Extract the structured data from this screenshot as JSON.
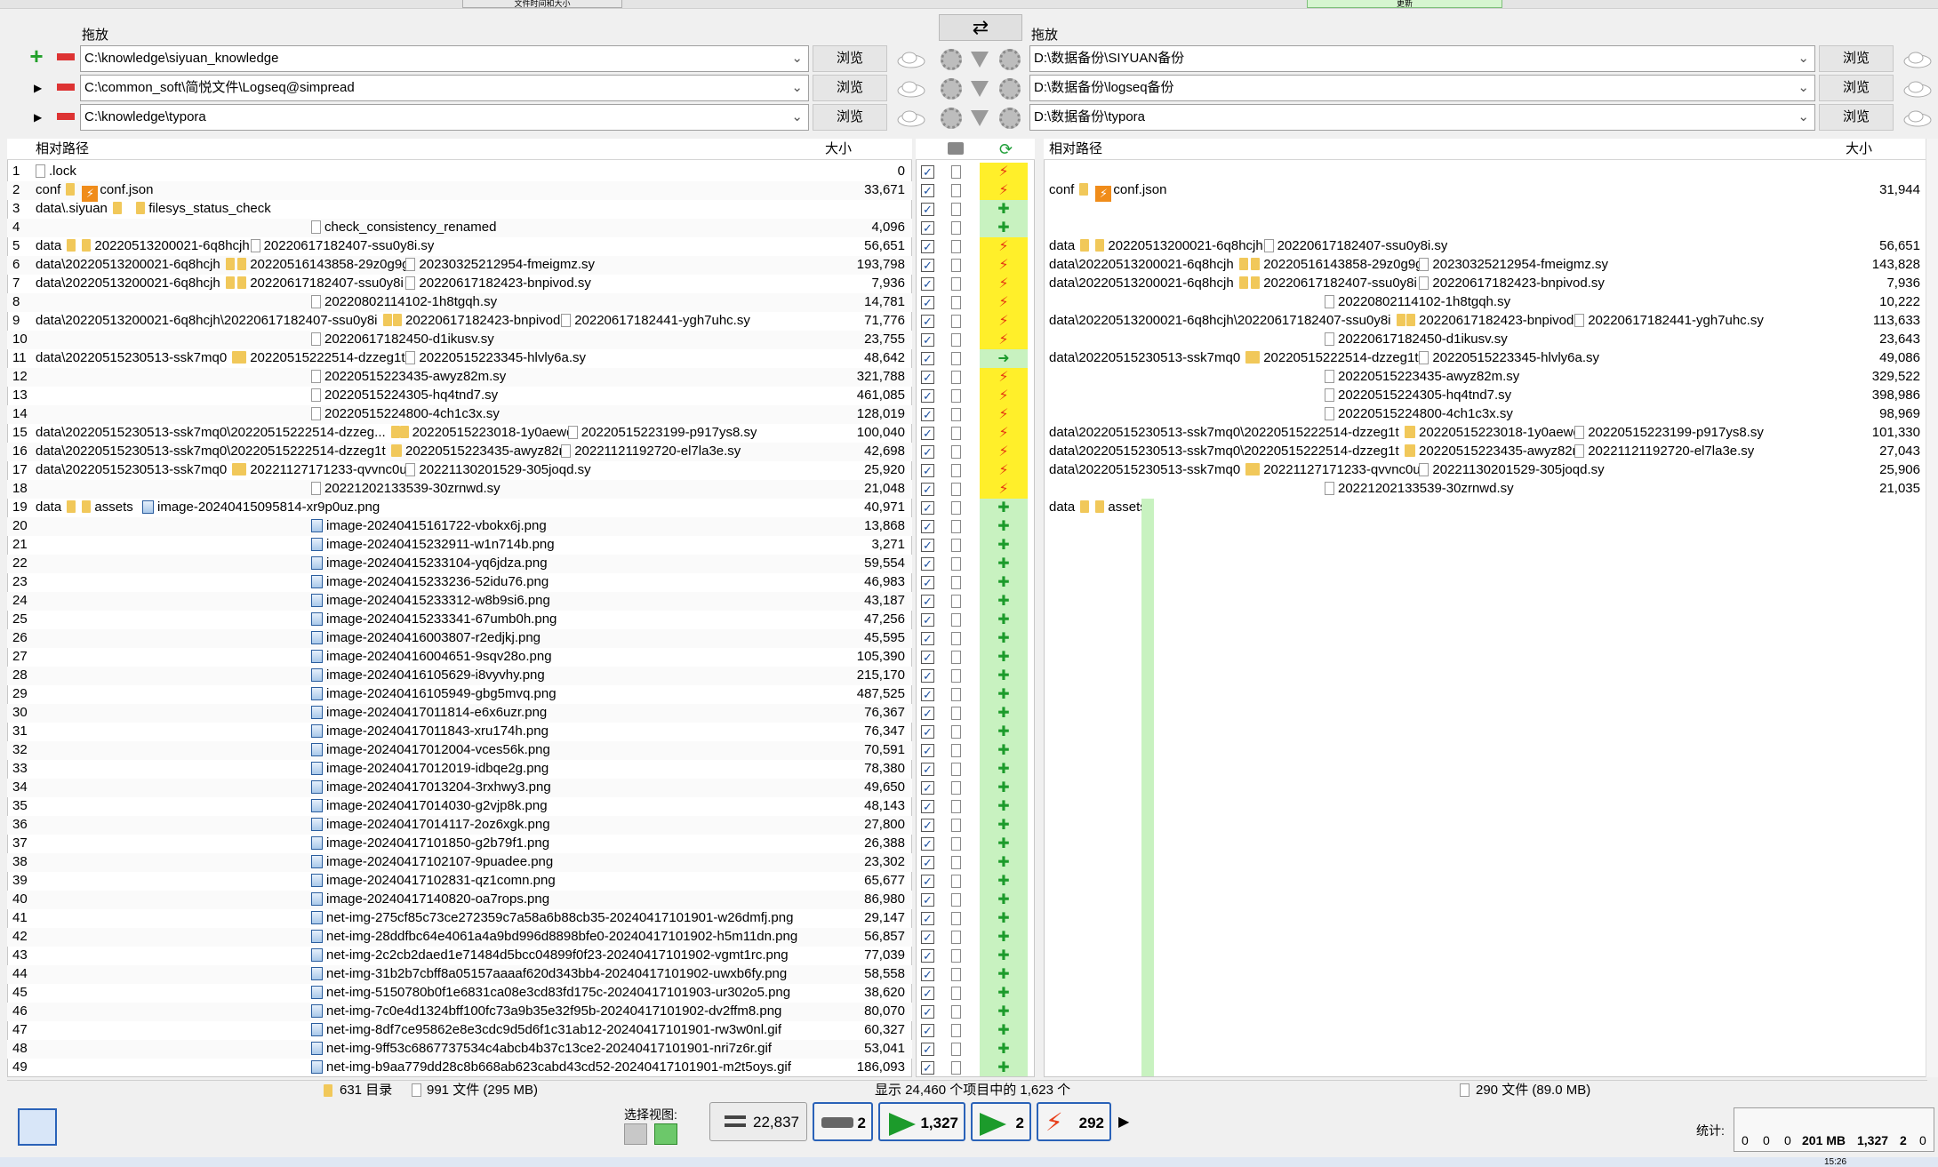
{
  "toolbar": {
    "drag_left": "拖放",
    "drag_right": "拖放",
    "browse": "浏览",
    "top_left_btn": "文件时间和大小",
    "top_right_btn": "更新"
  },
  "left_paths": [
    "C:\\knowledge\\siyuan_knowledge",
    "C:\\common_soft\\简悦文件\\Logseq@simpread",
    "C:\\knowledge\\typora"
  ],
  "right_paths": [
    "D:\\数据备份\\SIYUAN备份",
    "D:\\数据备份\\logseq备份",
    "D:\\数据备份\\typora"
  ],
  "headers": {
    "rel_path": "相对路径",
    "size": "大小"
  },
  "left_rows": [
    {
      "n": "1",
      "c": [
        ".lock"
      ],
      "s": "0",
      "a": "y"
    },
    {
      "n": "2",
      "c": [
        "conf",
        "conf.json"
      ],
      "s": "33,671",
      "a": "y"
    },
    {
      "n": "3",
      "c": [
        "data\\.siyuan",
        "filesys_status_check"
      ],
      "s": "",
      "a": "g"
    },
    {
      "n": "4",
      "c": [
        "",
        "",
        "check_consistency_renamed"
      ],
      "s": "4,096",
      "a": "g"
    },
    {
      "n": "5",
      "c": [
        "data",
        "20220513200021-6q8hcjh",
        "20220617182407-ssu0y8i.sy"
      ],
      "s": "56,651",
      "a": "y"
    },
    {
      "n": "6",
      "c": [
        "data\\20220513200021-6q8hcjh",
        "20220516143858-29z0g9g",
        "20230325212954-fmeigmz.sy"
      ],
      "s": "193,798",
      "a": "y"
    },
    {
      "n": "7",
      "c": [
        "data\\20220513200021-6q8hcjh",
        "20220617182407-ssu0y8i",
        "20220617182423-bnpivod.sy"
      ],
      "s": "7,936",
      "a": "y"
    },
    {
      "n": "8",
      "c": [
        "",
        "",
        "20220802114102-1h8tgqh.sy"
      ],
      "s": "14,781",
      "a": "y"
    },
    {
      "n": "9",
      "c": [
        "data\\20220513200021-6q8hcjh\\20220617182407-ssu0y8i",
        "20220617182423-bnpivod",
        "20220617182441-ygh7uhc.sy"
      ],
      "s": "71,776",
      "a": "y"
    },
    {
      "n": "10",
      "c": [
        "",
        "",
        "20220617182450-d1ikusv.sy"
      ],
      "s": "23,755",
      "a": "y"
    },
    {
      "n": "11",
      "c": [
        "data\\20220515230513-ssk7mq0",
        "20220515222514-dzzeg1t",
        "20220515223345-hlvly6a.sy"
      ],
      "s": "48,642",
      "a": "r"
    },
    {
      "n": "12",
      "c": [
        "",
        "",
        "20220515223435-awyz82m.sy"
      ],
      "s": "321,788",
      "a": "y"
    },
    {
      "n": "13",
      "c": [
        "",
        "",
        "20220515224305-hq4tnd7.sy"
      ],
      "s": "461,085",
      "a": "y"
    },
    {
      "n": "14",
      "c": [
        "",
        "",
        "20220515224800-4ch1c3x.sy"
      ],
      "s": "128,019",
      "a": "y"
    },
    {
      "n": "15",
      "c": [
        "data\\20220515230513-ssk7mq0\\20220515222514-dzzeg...",
        "20220515223018-1y0aewd",
        "20220515223199-p917ys8.sy"
      ],
      "s": "100,040",
      "a": "y"
    },
    {
      "n": "16",
      "c": [
        "data\\20220515230513-ssk7mq0\\20220515222514-dzzeg1t",
        "20220515223435-awyz82m",
        "20221121192720-el7la3e.sy"
      ],
      "s": "42,698",
      "a": "y"
    },
    {
      "n": "17",
      "c": [
        "data\\20220515230513-ssk7mq0",
        "20221127171233-qvvnc0u",
        "20221130201529-305joqd.sy"
      ],
      "s": "25,920",
      "a": "y"
    },
    {
      "n": "18",
      "c": [
        "",
        "",
        "20221202133539-30zrnwd.sy"
      ],
      "s": "21,048",
      "a": "y"
    },
    {
      "n": "19",
      "c": [
        "data",
        "assets",
        "image-20240415095814-xr9p0uz.png"
      ],
      "s": "40,971",
      "a": "g"
    },
    {
      "n": "20",
      "c": [
        "",
        "",
        "image-20240415161722-vbokx6j.png"
      ],
      "s": "13,868",
      "a": "g"
    },
    {
      "n": "21",
      "c": [
        "",
        "",
        "image-20240415232911-w1n714b.png"
      ],
      "s": "3,271",
      "a": "g"
    },
    {
      "n": "22",
      "c": [
        "",
        "",
        "image-20240415233104-yq6jdza.png"
      ],
      "s": "59,554",
      "a": "g"
    },
    {
      "n": "23",
      "c": [
        "",
        "",
        "image-20240415233236-52idu76.png"
      ],
      "s": "46,983",
      "a": "g"
    },
    {
      "n": "24",
      "c": [
        "",
        "",
        "image-20240415233312-w8b9si6.png"
      ],
      "s": "43,187",
      "a": "g"
    },
    {
      "n": "25",
      "c": [
        "",
        "",
        "image-20240415233341-67umb0h.png"
      ],
      "s": "47,256",
      "a": "g"
    },
    {
      "n": "26",
      "c": [
        "",
        "",
        "image-20240416003807-r2edjkj.png"
      ],
      "s": "45,595",
      "a": "g"
    },
    {
      "n": "27",
      "c": [
        "",
        "",
        "image-20240416004651-9sqv28o.png"
      ],
      "s": "105,390",
      "a": "g"
    },
    {
      "n": "28",
      "c": [
        "",
        "",
        "image-20240416105629-i8vyvhy.png"
      ],
      "s": "215,170",
      "a": "g"
    },
    {
      "n": "29",
      "c": [
        "",
        "",
        "image-20240416105949-gbg5mvq.png"
      ],
      "s": "487,525",
      "a": "g"
    },
    {
      "n": "30",
      "c": [
        "",
        "",
        "image-20240417011814-e6x6uzr.png"
      ],
      "s": "76,367",
      "a": "g"
    },
    {
      "n": "31",
      "c": [
        "",
        "",
        "image-20240417011843-xru174h.png"
      ],
      "s": "76,347",
      "a": "g"
    },
    {
      "n": "32",
      "c": [
        "",
        "",
        "image-20240417012004-vces56k.png"
      ],
      "s": "70,591",
      "a": "g"
    },
    {
      "n": "33",
      "c": [
        "",
        "",
        "image-20240417012019-idbqe2g.png"
      ],
      "s": "78,380",
      "a": "g"
    },
    {
      "n": "34",
      "c": [
        "",
        "",
        "image-20240417013204-3rxhwy3.png"
      ],
      "s": "49,650",
      "a": "g"
    },
    {
      "n": "35",
      "c": [
        "",
        "",
        "image-20240417014030-g2vjp8k.png"
      ],
      "s": "48,143",
      "a": "g"
    },
    {
      "n": "36",
      "c": [
        "",
        "",
        "image-20240417014117-2oz6xgk.png"
      ],
      "s": "27,800",
      "a": "g"
    },
    {
      "n": "37",
      "c": [
        "",
        "",
        "image-20240417101850-g2b79f1.png"
      ],
      "s": "26,388",
      "a": "g"
    },
    {
      "n": "38",
      "c": [
        "",
        "",
        "image-20240417102107-9puadee.png"
      ],
      "s": "23,302",
      "a": "g"
    },
    {
      "n": "39",
      "c": [
        "",
        "",
        "image-20240417102831-qz1comn.png"
      ],
      "s": "65,677",
      "a": "g"
    },
    {
      "n": "40",
      "c": [
        "",
        "",
        "image-20240417140820-oa7rops.png"
      ],
      "s": "86,980",
      "a": "g"
    },
    {
      "n": "41",
      "c": [
        "",
        "",
        "net-img-275cf85c73ce272359c7a58a6b88cb35-20240417101901-w26dmfj.png"
      ],
      "s": "29,147",
      "a": "g"
    },
    {
      "n": "42",
      "c": [
        "",
        "",
        "net-img-28ddfbc64e4061a4a9bd996d8898bfe0-20240417101902-h5m11dn.png"
      ],
      "s": "56,857",
      "a": "g"
    },
    {
      "n": "43",
      "c": [
        "",
        "",
        "net-img-2c2cb2daed1e71484d5bcc04899f0f23-20240417101902-vgmt1rc.png"
      ],
      "s": "77,039",
      "a": "g"
    },
    {
      "n": "44",
      "c": [
        "",
        "",
        "net-img-31b2b7cbff8a05157aaaaf620d343bb4-20240417101902-uwxb6fy.png"
      ],
      "s": "58,558",
      "a": "g"
    },
    {
      "n": "45",
      "c": [
        "",
        "",
        "net-img-5150780b0f1e6831ca08e3cd83fd175c-20240417101903-ur302o5.png"
      ],
      "s": "38,620",
      "a": "g"
    },
    {
      "n": "46",
      "c": [
        "",
        "",
        "net-img-7c0e4d1324bff100fc73a9b35e32f95b-20240417101902-dv2ffm8.png"
      ],
      "s": "80,070",
      "a": "g"
    },
    {
      "n": "47",
      "c": [
        "",
        "",
        "net-img-8df7ce95862e8e3cdc9d5d6f1c31ab12-20240417101901-rw3w0nl.gif"
      ],
      "s": "60,327",
      "a": "g"
    },
    {
      "n": "48",
      "c": [
        "",
        "",
        "net-img-9ff53c6867737534c4abcb4b37c13ce2-20240417101901-nri7z6r.gif"
      ],
      "s": "53,041",
      "a": "g"
    },
    {
      "n": "49",
      "c": [
        "",
        "",
        "net-img-b9aa779dd28c8b668ab623cabd43cd52-20240417101901-m2t5oys.gif"
      ],
      "s": "186,093",
      "a": "g"
    }
  ],
  "right_rows": [
    {
      "c": [],
      "s": ""
    },
    {
      "c": [
        "conf",
        "conf.json"
      ],
      "s": "31,944"
    },
    {
      "c": [],
      "s": ""
    },
    {
      "c": [],
      "s": ""
    },
    {
      "c": [
        "data",
        "20220513200021-6q8hcjh",
        "20220617182407-ssu0y8i.sy"
      ],
      "s": "56,651"
    },
    {
      "c": [
        "data\\20220513200021-6q8hcjh",
        "20220516143858-29z0g9g",
        "20230325212954-fmeigmz.sy"
      ],
      "s": "143,828"
    },
    {
      "c": [
        "data\\20220513200021-6q8hcjh",
        "20220617182407-ssu0y8i",
        "20220617182423-bnpivod.sy"
      ],
      "s": "7,936"
    },
    {
      "c": [
        "",
        "",
        "20220802114102-1h8tgqh.sy"
      ],
      "s": "10,222"
    },
    {
      "c": [
        "data\\20220513200021-6q8hcjh\\20220617182407-ssu0y8i",
        "20220617182423-bnpivod",
        "20220617182441-ygh7uhc.sy"
      ],
      "s": "113,633"
    },
    {
      "c": [
        "",
        "",
        "20220617182450-d1ikusv.sy"
      ],
      "s": "23,643"
    },
    {
      "c": [
        "data\\20220515230513-ssk7mq0",
        "20220515222514-dzzeg1t",
        "20220515223345-hlvly6a.sy"
      ],
      "s": "49,086"
    },
    {
      "c": [
        "",
        "",
        "20220515223435-awyz82m.sy"
      ],
      "s": "329,522"
    },
    {
      "c": [
        "",
        "",
        "20220515224305-hq4tnd7.sy"
      ],
      "s": "398,986"
    },
    {
      "c": [
        "",
        "",
        "20220515224800-4ch1c3x.sy"
      ],
      "s": "98,969"
    },
    {
      "c": [
        "data\\20220515230513-ssk7mq0\\20220515222514-dzzeg1t",
        "20220515223018-1y0aewd",
        "20220515223199-p917ys8.sy"
      ],
      "s": "101,330"
    },
    {
      "c": [
        "data\\20220515230513-ssk7mq0\\20220515222514-dzzeg1t",
        "20220515223435-awyz82m",
        "20221121192720-el7la3e.sy"
      ],
      "s": "27,043"
    },
    {
      "c": [
        "data\\20220515230513-ssk7mq0",
        "20221127171233-qvvnc0u",
        "20221130201529-305joqd.sy"
      ],
      "s": "25,906"
    },
    {
      "c": [
        "",
        "",
        "20221202133539-30zrnwd.sy"
      ],
      "s": "21,035"
    },
    {
      "c": [
        "data",
        "assets"
      ],
      "s": ""
    }
  ],
  "status": {
    "left_dirs": "631 目录",
    "left_files": "991 文件 (295 MB)",
    "center": "显示 24,460 个项目中的 1,623 个",
    "right_files": "290 文件 (89.0 MB)"
  },
  "bottom": {
    "select_view": "选择视图:",
    "equal_count": "22,837",
    "diff_count": "2",
    "create_count": "1,327",
    "update_count": "2",
    "conflict_count": "292",
    "stats_label": "统计:",
    "stats": [
      "0",
      "0",
      "0",
      "201 MB",
      "1,327",
      "2",
      "0"
    ],
    "time": "15:26"
  }
}
